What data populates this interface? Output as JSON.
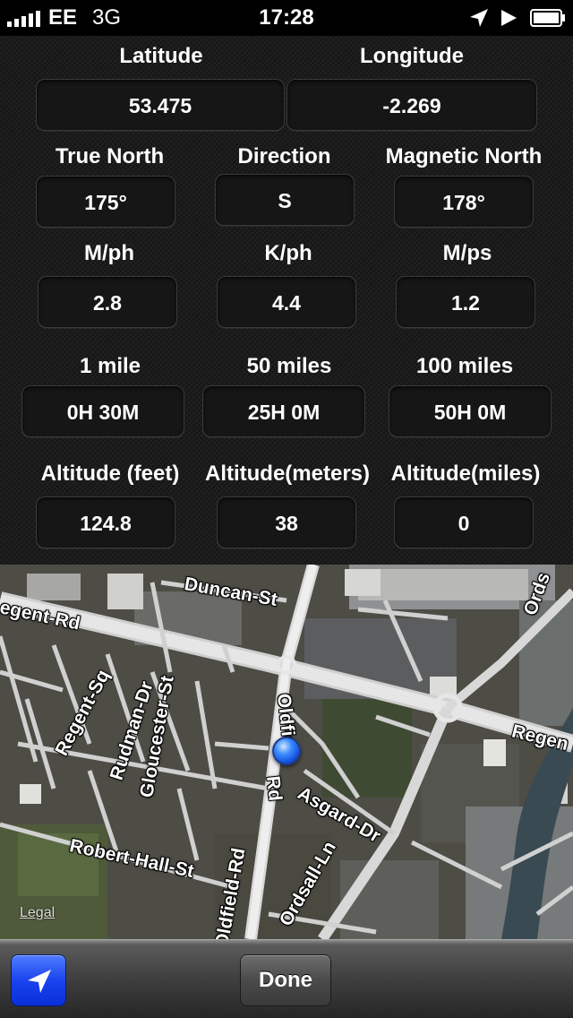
{
  "status_bar": {
    "carrier": "EE",
    "network": "3G",
    "time": "17:28"
  },
  "coordinates": {
    "latitude_label": "Latitude",
    "longitude_label": "Longitude",
    "latitude": "53.475",
    "longitude": "-2.269"
  },
  "heading": {
    "true_north_label": "True North",
    "direction_label": "Direction",
    "magnetic_north_label": "Magnetic North",
    "true_north": "175°",
    "direction": "S",
    "magnetic_north": "178°"
  },
  "speed": {
    "mph_label": "M/ph",
    "kph_label": "K/ph",
    "mps_label": "M/ps",
    "mph": "2.8",
    "kph": "4.4",
    "mps": "1.2"
  },
  "eta": {
    "one_mile_label": "1 mile",
    "fifty_miles_label": "50 miles",
    "hundred_miles_label": "100 miles",
    "one_mile": "0H 30M",
    "fifty_miles": "25H 0M",
    "hundred_miles": "50H 0M"
  },
  "altitude": {
    "feet_label": "Altitude (feet)",
    "meters_label": "Altitude(meters)",
    "miles_label": "Altitude(miles)",
    "feet": "124.8",
    "meters": "38",
    "miles": "0"
  },
  "map": {
    "streets": {
      "duncan": "Duncan-St",
      "regent_rd_left": "egent-Rd",
      "regent_rd_right": "Regen",
      "regent_sq": "Regent-Sq",
      "rudman": "Rudman-Dr",
      "gloucester": "Gloucester-St",
      "oldfield_top": "Oldfie",
      "oldfield_rd": "Rd",
      "oldfield_bottom": "Oldfield-Rd",
      "asgard": "Asgard-Dr",
      "ordsall": "Ordsall-Ln",
      "ords_top": "Ords",
      "robert_hall": "Robert-Hall-St"
    },
    "legal": "Legal"
  },
  "toolbar": {
    "done_label": "Done"
  },
  "icons": {
    "locate": "location-arrow-icon",
    "status_location": "location-arrow-icon",
    "status_play": "play-icon",
    "battery": "battery-icon",
    "signal": "signal-bars-icon"
  },
  "colors": {
    "panel_background": "#1c1c1c",
    "value_box": "#161616",
    "locate_button": "#1a44ee",
    "user_pin": "#3b8cff"
  }
}
